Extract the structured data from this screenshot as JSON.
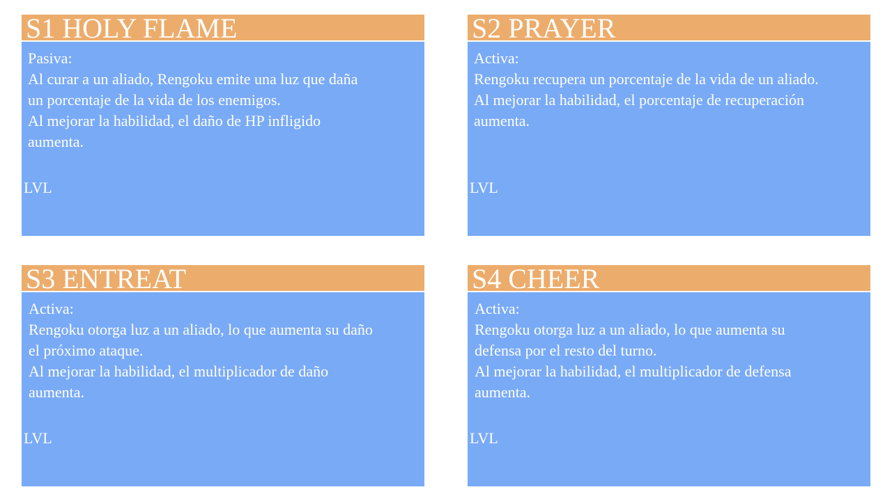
{
  "skills": [
    {
      "title": "S1 HOLY FLAME",
      "lines": [
        "Pasiva:",
        "Al curar a un aliado, Rengoku emite una luz que daña",
        "un porcentaje de la vida de los enemigos.",
        "Al mejorar la habilidad, el daño de HP infligido",
        "aumenta."
      ],
      "level_label": "LVL"
    },
    {
      "title": "S2 PRAYER",
      "lines": [
        "Activa:",
        "Rengoku recupera un porcentaje de la vida de un aliado.",
        "Al mejorar la habilidad, el porcentaje de recuperación",
        "aumenta."
      ],
      "level_label": "LVL"
    },
    {
      "title": "S3 ENTREAT",
      "lines": [
        "Activa:",
        "Rengoku otorga luz a un aliado, lo que aumenta su daño",
        "el próximo ataque.",
        "Al mejorar la habilidad, el multiplicador de daño",
        "aumenta."
      ],
      "level_label": "LVL"
    },
    {
      "title": "S4 CHEER",
      "lines": [
        "Activa:",
        "Rengoku otorga luz a un aliado, lo que aumenta su",
        "defensa por el resto del turno.",
        "Al mejorar la habilidad, el multiplicador de defensa",
        "aumenta."
      ],
      "level_label": "LVL"
    }
  ],
  "colors": {
    "header": "#ECAC6C",
    "body": "#79AAF6",
    "text": "#FFFFFF"
  }
}
